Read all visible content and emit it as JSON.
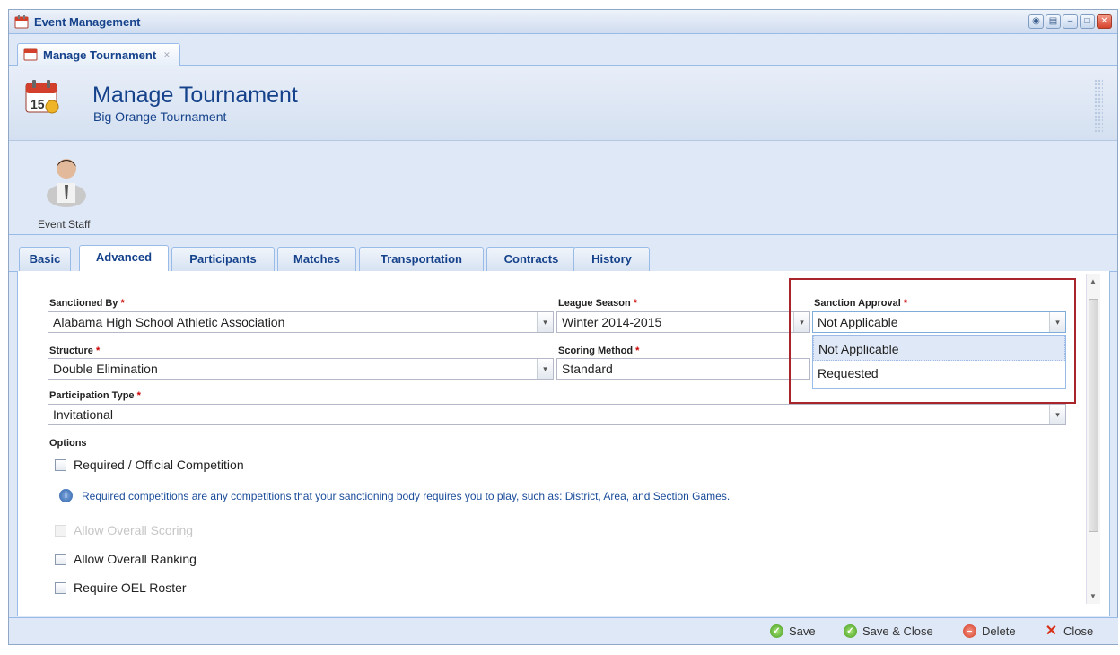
{
  "window": {
    "title": "Event Management"
  },
  "window_buttons": [
    "◉",
    "▤",
    "–",
    "□",
    "✕"
  ],
  "doc_tab": {
    "label": "Manage Tournament",
    "close": "✕"
  },
  "header": {
    "title": "Manage Tournament",
    "subtitle": "Big Orange Tournament",
    "icon_day": "15"
  },
  "staff": {
    "label": "Event Staff"
  },
  "tabs": [
    "Basic",
    "Advanced",
    "Participants",
    "Matches",
    "Transportation",
    "Contracts",
    "History"
  ],
  "active_tab": "Advanced",
  "form": {
    "sanctioned_by": {
      "label": "Sanctioned By",
      "value": "Alabama High School Athletic Association"
    },
    "league_season": {
      "label": "League Season",
      "value": "Winter 2014-2015"
    },
    "sanction_approval": {
      "label": "Sanction Approval",
      "value": "Not Applicable"
    },
    "structure": {
      "label": "Structure",
      "value": "Double Elimination"
    },
    "scoring_method": {
      "label": "Scoring Method",
      "value": "Standard"
    },
    "participation_type": {
      "label": "Participation Type",
      "value": "Invitational"
    },
    "required_marker": "*",
    "trigger_glyph": "▾"
  },
  "dropdown": {
    "options": [
      "Not Applicable",
      "Requested"
    ],
    "selected": "Not Applicable"
  },
  "options": {
    "label": "Options",
    "required_competition": "Required / Official Competition",
    "info": "Required competitions are any competitions that your sanctioning body requires you to play, such as: District, Area, and Section Games.",
    "info_glyph": "i",
    "allow_overall_scoring": "Allow Overall Scoring",
    "allow_overall_ranking": "Allow Overall Ranking",
    "require_oel_roster": "Require OEL Roster"
  },
  "footer": {
    "save": "Save",
    "save_close": "Save & Close",
    "delete": "Delete",
    "close": "Close"
  },
  "colors": {
    "title": "#15428b",
    "highlight": "#a8252c",
    "frame": "#99bbe8"
  }
}
